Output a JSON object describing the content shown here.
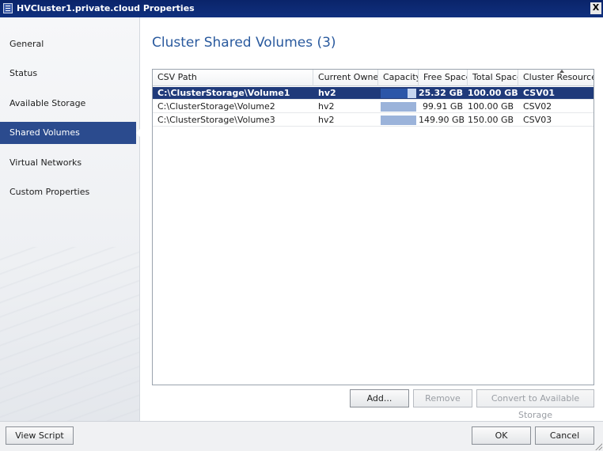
{
  "window": {
    "title": "HVCluster1.private.cloud Properties",
    "close_label": "X"
  },
  "sidebar": {
    "items": [
      {
        "label": "General"
      },
      {
        "label": "Status"
      },
      {
        "label": "Available Storage"
      },
      {
        "label": "Shared Volumes",
        "active": true
      },
      {
        "label": "Virtual Networks"
      },
      {
        "label": "Custom Properties"
      }
    ]
  },
  "main": {
    "title": "Cluster Shared Volumes (3)",
    "table": {
      "columns": [
        "CSV Path",
        "Current Owner",
        "Capacity",
        "Free Space",
        "Total Space",
        "Cluster Resource"
      ],
      "sorted_column": "Cluster Resource",
      "rows": [
        {
          "path": "C:\\ClusterStorage\\Volume1",
          "owner": "hv2",
          "capacity_used_fraction": 0.75,
          "free": "25.32 GB",
          "total": "100.00 GB",
          "resource": "CSV01",
          "selected": true
        },
        {
          "path": "C:\\ClusterStorage\\Volume2",
          "owner": "hv2",
          "capacity_used_fraction": 0.0,
          "free": "99.91 GB",
          "total": "100.00 GB",
          "resource": "CSV02",
          "selected": false
        },
        {
          "path": "C:\\ClusterStorage\\Volume3",
          "owner": "hv2",
          "capacity_used_fraction": 0.0,
          "free": "149.90 GB",
          "total": "150.00 GB",
          "resource": "CSV03",
          "selected": false
        }
      ]
    },
    "buttons": {
      "add": "Add...",
      "remove": "Remove",
      "convert": "Convert to Available Storage"
    }
  },
  "footer": {
    "view_script": "View Script",
    "ok": "OK",
    "cancel": "Cancel"
  },
  "colors": {
    "titlebar": "#0a246a",
    "nav_active": "#2b4b8e",
    "heading": "#2a5a9e",
    "row_selected": "#1f3a7a",
    "capacity_bar": "#9bb3da"
  }
}
